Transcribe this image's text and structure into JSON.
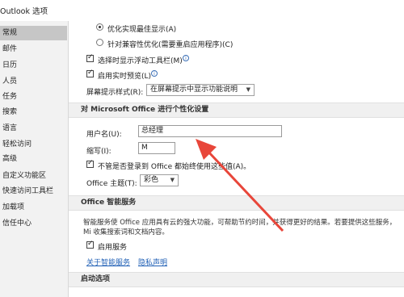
{
  "window": {
    "title": "Outlook 选项"
  },
  "sidebar": {
    "items": [
      {
        "label": "常规",
        "selected": true
      },
      {
        "label": "邮件"
      },
      {
        "label": "日历"
      },
      {
        "label": "人员"
      },
      {
        "label": "任务"
      },
      {
        "label": "搜索"
      },
      {
        "label": "语言"
      },
      {
        "label": "轻松访问"
      },
      {
        "label": "高级"
      },
      {
        "label": "自定义功能区"
      },
      {
        "label": "快速访问工具栏"
      },
      {
        "label": "加载项"
      },
      {
        "label": "信任中心"
      }
    ]
  },
  "ui_options": {
    "radio_best_display": "优化实现最佳显示(A)",
    "radio_compat": "针对兼容性优化(需要重启应用程序)(C)",
    "check_mini_toolbar": "选择时显示浮动工具栏(M)",
    "check_live_preview": "启用实时预览(L)",
    "screentip_label": "屏幕提示样式(R):",
    "screentip_value": "在屏幕提示中显示功能说明"
  },
  "personalize": {
    "header": "对 Microsoft Office 进行个性化设置",
    "username_label": "用户名(U):",
    "username_value": "总经理",
    "initials_label": "缩写(I):",
    "initials_value": "M",
    "always_use_label": "不管是否登录到 Office 都始终使用这些值(A)。",
    "theme_label": "Office 主题(T):",
    "theme_value": "彩色"
  },
  "intelligent": {
    "header": "Office 智能服务",
    "description": "智能服务使 Office 应用具有云的强大功能，可帮助节约时间，并获得更好的结果。若要提供这些服务，Mi 收集搜索词和文档内容。",
    "enable_label": "启用服务",
    "about_link": "关于智能服务",
    "privacy_link": "隐私声明"
  },
  "startup": {
    "header": "启动选项"
  },
  "colors": {
    "arrow": "#e8463a",
    "selected_nav": "#c6c6c6"
  }
}
